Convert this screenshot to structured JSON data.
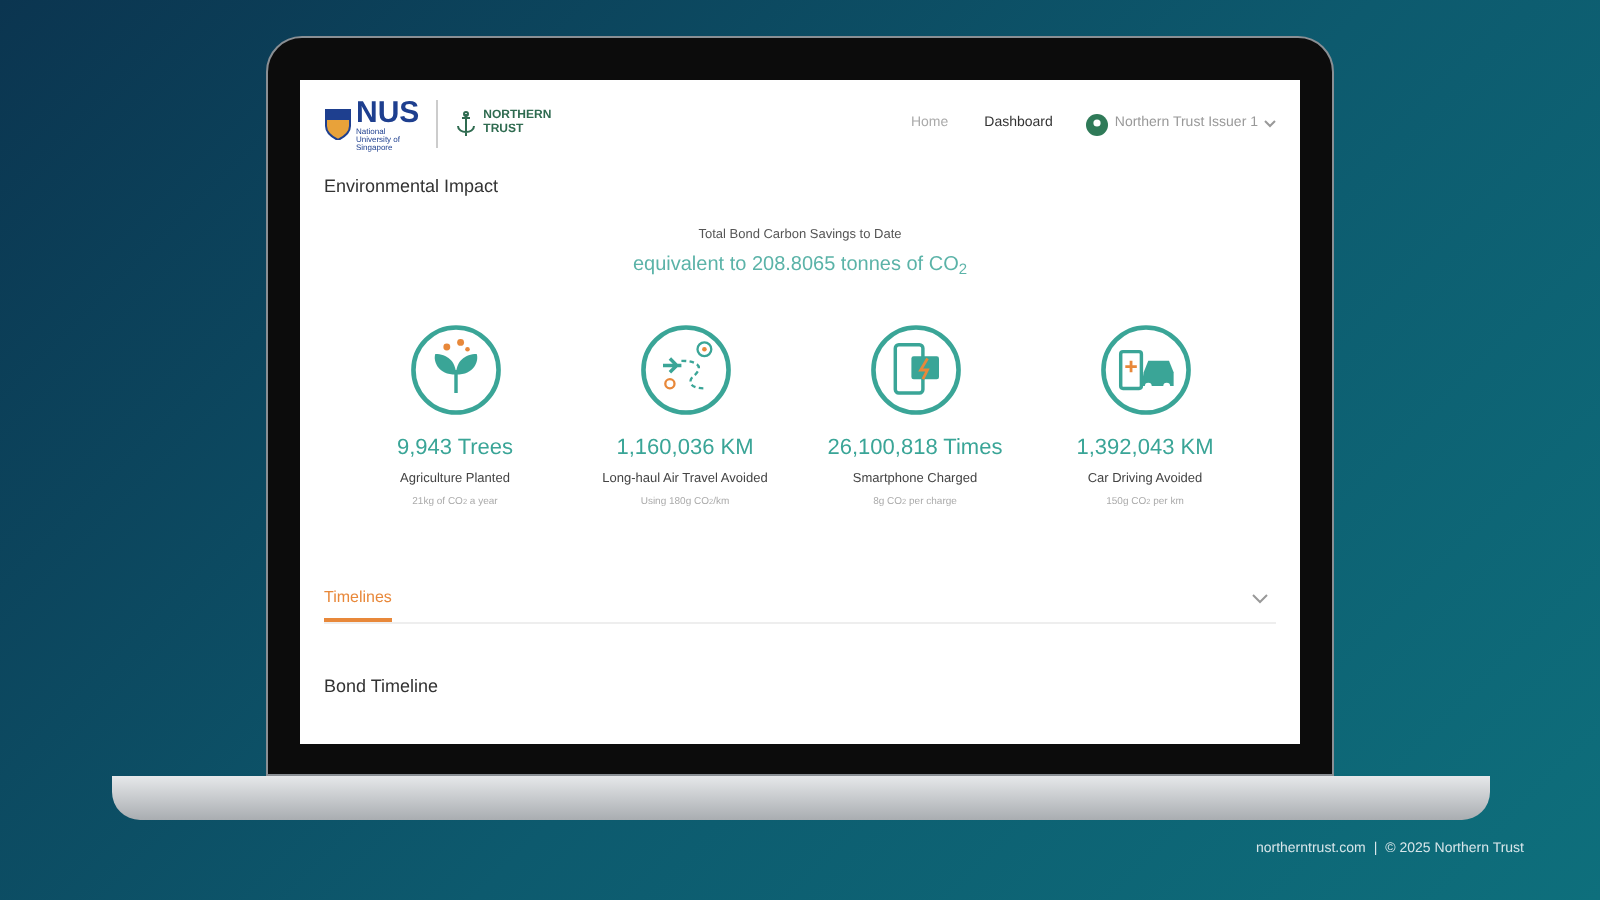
{
  "header": {
    "logo_primary": {
      "wordmark": "NUS",
      "subtitle": "National University of Singapore"
    },
    "logo_secondary": {
      "wordmark": "NORTHERN TRUST"
    },
    "nav": [
      {
        "label": "Home",
        "selected": false
      },
      {
        "label": "Dashboard",
        "selected": true
      }
    ],
    "user": {
      "name": "Northern Trust Issuer 1"
    }
  },
  "section_title": "Environmental Impact",
  "summary": {
    "label": "Total Bond Carbon Savings to Date",
    "value": "equivalent to 208.8065 tonnes of CO$_{2}$"
  },
  "metrics": [
    {
      "kind": "plant",
      "value": "9,943 Trees",
      "label": "Agriculture Planted",
      "note": "21kg of CO$_{2}$ a year"
    },
    {
      "kind": "flight",
      "value": "1,160,036 KM",
      "label": "Long-haul Air Travel Avoided",
      "note": "Using 180g CO$_{2}$/km"
    },
    {
      "kind": "phone",
      "value": "26,100,818 Times",
      "label": "Smartphone Charged",
      "note": "8g CO$_{2}$ per charge"
    },
    {
      "kind": "car",
      "value": "1,392,043 KM",
      "label": "Car Driving Avoided",
      "note": "150g CO$_{2}$ per km"
    }
  ],
  "tabs": [
    {
      "label": "Timelines",
      "selected": true
    }
  ],
  "next_section_title": "Bond Timeline",
  "footer": {
    "site": "northerntrust.com",
    "separator": "|",
    "copyright": "© 2025 Northern Trust"
  }
}
